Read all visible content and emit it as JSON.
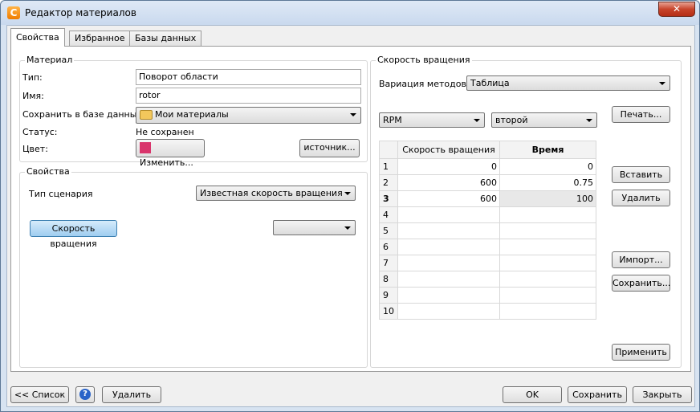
{
  "window": {
    "title": "Редактор материалов",
    "close_glyph": "✕",
    "app_icon_glyph": "C"
  },
  "tabs": [
    {
      "label": "Свойства",
      "active": true
    },
    {
      "label": "Избранное",
      "active": false
    },
    {
      "label": "Базы данных",
      "active": false
    }
  ],
  "material": {
    "group_title": "Материал",
    "type_label": "Тип:",
    "type_value": "Поворот области",
    "name_label": "Имя:",
    "name_value": "rotor",
    "save_label": "Сохранить в базе данных:",
    "save_value": "Мои материалы",
    "status_label": "Статус:",
    "status_value": "Не сохранен",
    "color_label": "Цвет:",
    "color_hex": "#d9356c",
    "change_button": "Изменить...",
    "source_button": "источник..."
  },
  "properties": {
    "group_title": "Свойства",
    "scenario_label": "Тип сценария",
    "scenario_value": "Известная скорость вращения",
    "speed_button": "Скорость вращения",
    "speed_select_value": ""
  },
  "rotation_speed": {
    "group_title": "Скорость вращения",
    "method_label": "Вариация методов:",
    "method_value": "Таблица",
    "units_value": "RPM",
    "order_value": "второй",
    "print_button": "Печать...",
    "insert_button": "Вставить",
    "delete_button": "Удалить",
    "import_button": "Импорт...",
    "save_button": "Сохранить...",
    "apply_button": "Применить",
    "table": {
      "columns": [
        "Скорость вращения",
        "Время"
      ],
      "rows": [
        {
          "n": "1",
          "speed": "0",
          "time": "0"
        },
        {
          "n": "2",
          "speed": "600",
          "time": "0.75"
        },
        {
          "n": "3",
          "speed": "600",
          "time": "100"
        },
        {
          "n": "4",
          "speed": "",
          "time": ""
        },
        {
          "n": "5",
          "speed": "",
          "time": ""
        },
        {
          "n": "6",
          "speed": "",
          "time": ""
        },
        {
          "n": "7",
          "speed": "",
          "time": ""
        },
        {
          "n": "8",
          "speed": "",
          "time": ""
        },
        {
          "n": "9",
          "speed": "",
          "time": ""
        },
        {
          "n": "10",
          "speed": "",
          "time": ""
        }
      ]
    }
  },
  "footer": {
    "list_button": "<< Список",
    "help_glyph": "?",
    "delete_button": "Удалить",
    "ok_button": "OK",
    "save_button": "Сохранить",
    "close_button": "Закрыть"
  }
}
